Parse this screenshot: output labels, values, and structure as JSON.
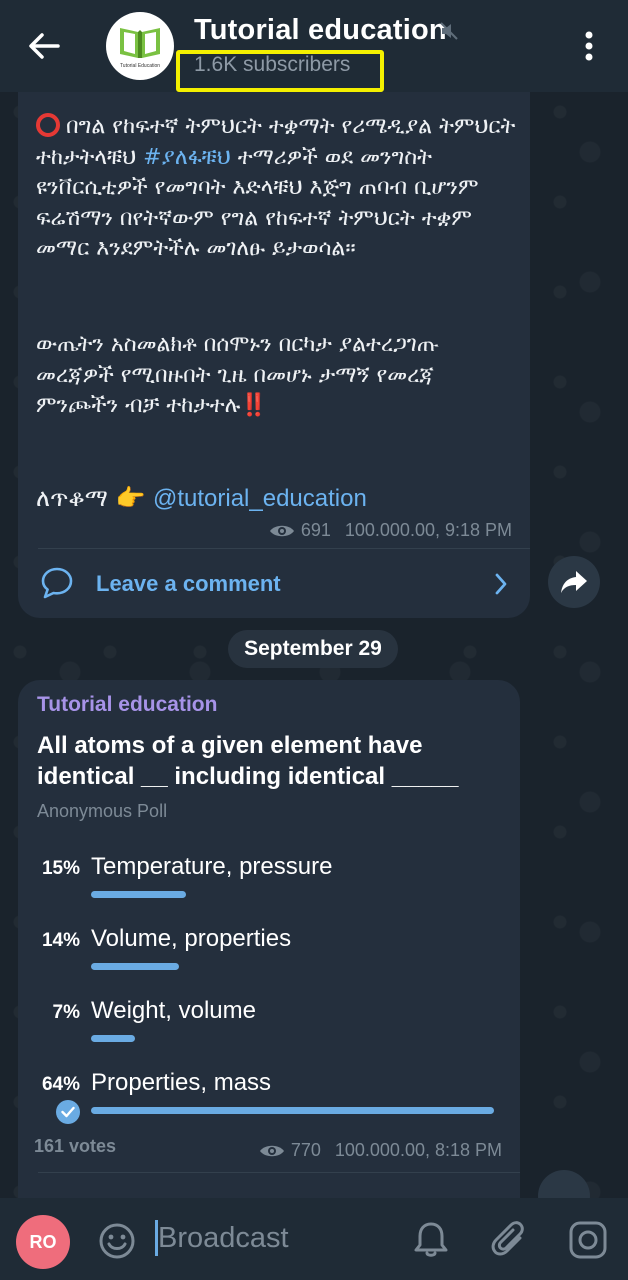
{
  "header": {
    "title": "Tutorial education",
    "subscribers": "1.6K subscribers",
    "avatar_caption": "Tutorial Education"
  },
  "post": {
    "paragraph1_prefix": "በግል የከፍተኛ ትምህርት ተቋማት የሪሜዲያል ትምህርት ተከታትላቹህ ",
    "hashtag": "#ያለፋቹህ",
    "paragraph1_suffix": " ተማሪዎች ወደ መንግስት ዩንቨርሲቲዎች የመግባት እድላቹህ እጅግ ጠባብ ቢሆንም ፍሬሽማን በየትኛውም የግል የከፍተኛ ትምህርት ተቋም መማር እንደምትችሉ መገለፁ ይታወሳል።",
    "paragraph2": "ውጤትን አስመልክቶ በሰሞኑን በርካታ ያልተረጋገጡ መረጃዎች የሚበዙበት ጊዜ በመሆኑ ታማኝ የመረጃ ምንጮችን ብቻ ተከታተሉ",
    "paragraph2_emoji": "‼️",
    "signature_prefix": "ለጥቆማ 👉 ",
    "signature_handle": "@tutorial_education",
    "views": "691",
    "time": "100.000.00, 9:18 PM",
    "comment_label": "Leave a comment"
  },
  "date_separator": "September 29",
  "poll": {
    "author": "Tutorial education",
    "question": "All atoms of a given element have identical __ including identical _____",
    "type": "Anonymous Poll",
    "options": [
      {
        "pct": "15%",
        "label": "Temperature, pressure",
        "fraction": 0.15
      },
      {
        "pct": "14%",
        "label": "Volume, properties",
        "fraction": 0.14
      },
      {
        "pct": "7%",
        "label": "Weight, volume",
        "fraction": 0.07
      },
      {
        "pct": "64%",
        "label": "Properties, mass",
        "fraction": 0.64,
        "chosen": true
      }
    ],
    "votes": "161 votes",
    "views": "770",
    "time": "100.000.00, 8:18 PM"
  },
  "composer": {
    "avatar_initials": "RO",
    "placeholder": "Broadcast"
  },
  "colors": {
    "accent": "#6aabe3",
    "author": "#a793e8",
    "highlight": "#f4f000",
    "avatar": "#ef6d7c"
  }
}
